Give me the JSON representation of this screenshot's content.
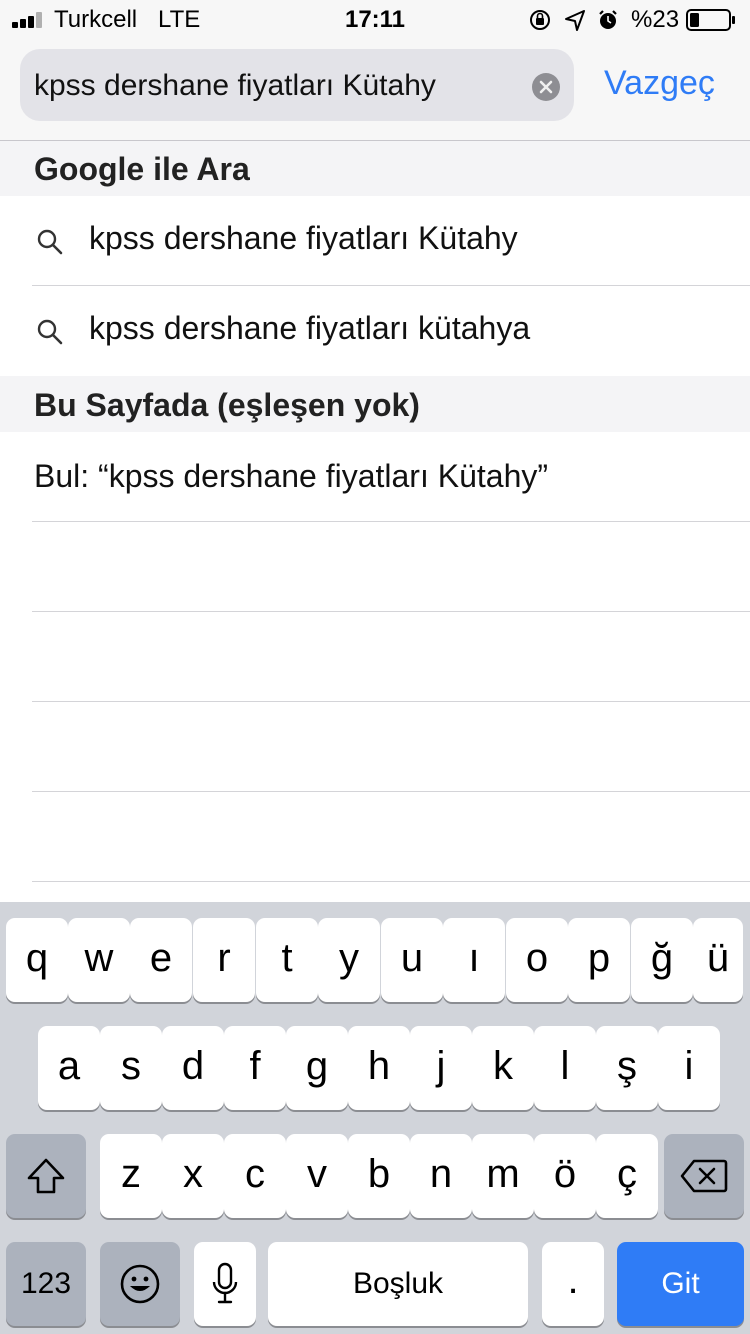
{
  "status_bar": {
    "carrier": "Turkcell",
    "network": "LTE",
    "time": "17:11",
    "battery_percent": "%23",
    "icons": [
      "orientation-lock-icon",
      "location-arrow-icon",
      "alarm-icon",
      "battery-icon"
    ]
  },
  "search": {
    "query": "kpss dershane fiyatları Kütahy",
    "cancel_label": "Vazgeç"
  },
  "sections": {
    "google_header": "Google ile Ara",
    "suggestions": [
      {
        "text": "kpss dershane fiyatları Kütahy"
      },
      {
        "text": "kpss dershane fiyatları kütahya"
      }
    ],
    "page_header": "Bu Sayfada (eşleşen yok)",
    "find_label": "Bul: “kpss dershane fiyatları Kütahy”"
  },
  "keyboard": {
    "row1": [
      "q",
      "w",
      "e",
      "r",
      "t",
      "y",
      "u",
      "ı",
      "o",
      "p",
      "ğ",
      "ü"
    ],
    "row2": [
      "a",
      "s",
      "d",
      "f",
      "g",
      "h",
      "j",
      "k",
      "l",
      "ş",
      "i"
    ],
    "row3": [
      "z",
      "x",
      "c",
      "v",
      "b",
      "n",
      "m",
      "ö",
      "ç"
    ],
    "numbers_label": "123",
    "space_label": "Boşluk",
    "period_label": ".",
    "go_label": "Git"
  },
  "colors": {
    "accent": "#2f7cf6",
    "keyboard_bg": "#d1d4da",
    "special_key": "#acb2bd"
  }
}
